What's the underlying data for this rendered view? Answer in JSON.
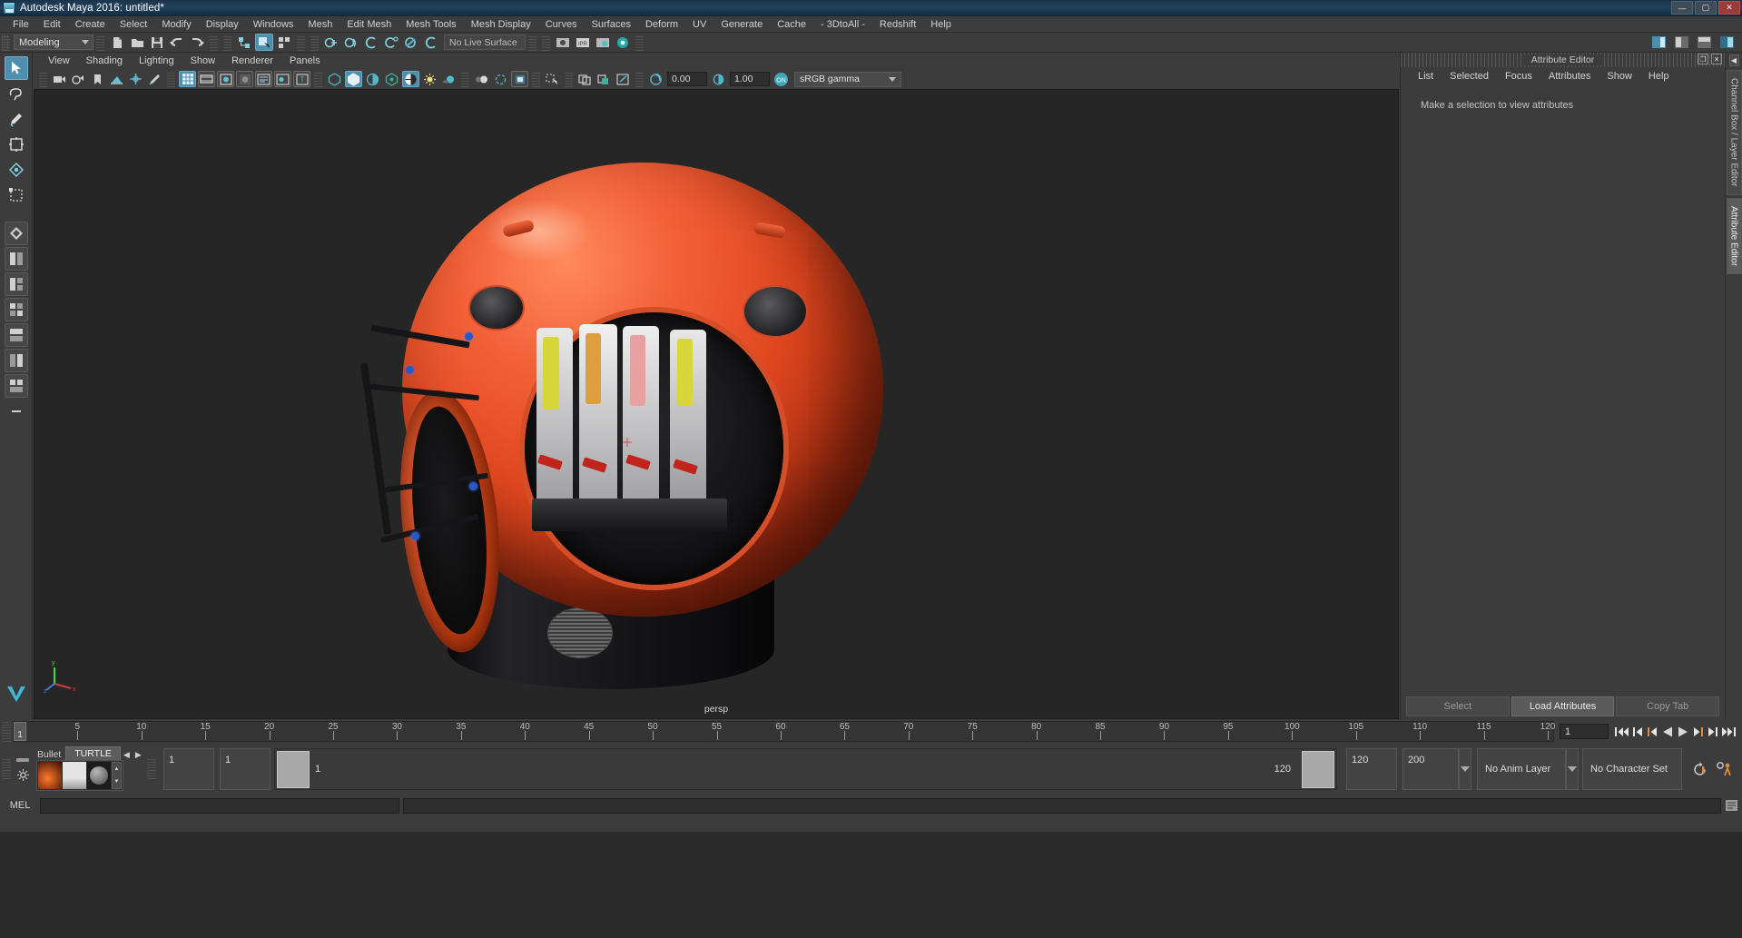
{
  "window": {
    "title": "Autodesk Maya 2016: untitled*",
    "minimize": "—",
    "maximize": "▢",
    "close": "✕"
  },
  "menubar": {
    "items": [
      "File",
      "Edit",
      "Create",
      "Select",
      "Modify",
      "Display",
      "Windows",
      "Mesh",
      "Edit Mesh",
      "Mesh Tools",
      "Mesh Display",
      "Curves",
      "Surfaces",
      "Deform",
      "UV",
      "Generate",
      "Cache",
      "- 3DtoAll -",
      "Redshift",
      "Help"
    ]
  },
  "statusline": {
    "mode": "Modeling",
    "live_surface": "No Live Surface",
    "icons": [
      "new-scene-icon",
      "open-scene-icon",
      "save-scene-icon",
      "undo-icon",
      "redo-icon",
      "select-by-hierarchy-icon",
      "select-by-object-icon",
      "select-by-component-icon",
      "snap-to-grids-icon",
      "snap-to-curves-icon",
      "snap-to-points-icon",
      "snap-to-projected-center-icon",
      "snap-to-view-planes-icon",
      "make-live-icon",
      "render-current-frame-icon",
      "ipr-render-icon",
      "render-settings-icon",
      "hypershade-icon",
      "render-view-icon"
    ]
  },
  "panel": {
    "menu": [
      "View",
      "Shading",
      "Lighting",
      "Show",
      "Renderer",
      "Panels"
    ],
    "toolbar_icons": [
      "select-camera-icon",
      "camera-attributes-icon",
      "bookmarks-icon",
      "image-plane-icon",
      "2d-pan-zoom-icon",
      "grease-pencil-icon",
      "grid-toggle-icon",
      "film-gate-icon",
      "resolution-gate-icon",
      "gate-mask-icon",
      "film-origin-icon",
      "safe-action-icon",
      "field-chart-icon",
      "wireframe-icon",
      "smooth-shade-icon",
      "shaded-wireframe-icon",
      "hardware-texturing-icon",
      "use-all-lights-icon",
      "shadows-icon",
      "screen-space-ao-icon",
      "motion-blur-icon",
      "multisample-icon",
      "isolate-select-icon",
      "xray-icon",
      "xray-joints-icon",
      "xray-active-components-icon",
      "exposure-icon",
      "gamma-icon",
      "color-management-icon"
    ],
    "exposure_value": "0.00",
    "gamma_value": "1.00",
    "color_profile": "sRGB gamma",
    "toggle_state": "ON",
    "camera_label": "persp"
  },
  "toolbox": {
    "tools": [
      "select-tool",
      "lasso-select-tool",
      "paint-select-tool",
      "move-tool",
      "rotate-tool",
      "scale-tool",
      "last-tool-used",
      "snap-grid-tool",
      "layout-single-icon",
      "layout-two-pane-icon",
      "layout-four-pane-icon",
      "layout-persp-outliner-icon",
      "layout-persp-graph-icon",
      "layout-hypershade-icon",
      "layout-more-icon"
    ]
  },
  "attribute_editor": {
    "title": "Attribute Editor",
    "dock_buttons": [
      "undock-icon",
      "close-icon"
    ],
    "menu": [
      "List",
      "Selected",
      "Focus",
      "Attributes",
      "Show",
      "Help"
    ],
    "empty_message": "Make a selection to view attributes",
    "buttons": {
      "select": "Select",
      "load_attributes": "Load Attributes",
      "copy_tab": "Copy Tab"
    },
    "active_button": "Load Attributes"
  },
  "side_tabs": {
    "items": [
      "Channel Box / Layer Editor",
      "Attribute Editor"
    ],
    "active": "Attribute Editor",
    "collapse": "◀"
  },
  "timeline": {
    "start": 1,
    "end": 120,
    "current_frame": "1",
    "tick_labels": [
      "5",
      "10",
      "15",
      "20",
      "25",
      "30",
      "35",
      "40",
      "45",
      "50",
      "55",
      "60",
      "65",
      "70",
      "75",
      "80",
      "85",
      "90",
      "95",
      "100",
      "105",
      "110",
      "115",
      "120"
    ],
    "frame_field": "1",
    "playback_buttons": [
      "go-to-start-icon",
      "step-back-frame-icon",
      "step-back-key-icon",
      "play-backwards-icon",
      "play-forwards-icon",
      "step-forward-key-icon",
      "step-forward-frame-icon",
      "go-to-end-icon"
    ]
  },
  "range_slider": {
    "anim_start": "1",
    "anim_end": "1",
    "range_start": "1",
    "range_end": "120",
    "playback_end": "120",
    "anim_end_total": "200",
    "anim_layer": "No Anim Layer",
    "character_set": "No Character Set",
    "right_icons": [
      "auto-key-icon",
      "animation-preferences-icon"
    ]
  },
  "shelf": {
    "tabs": [
      "Bullet",
      "TURTLE"
    ],
    "active_tab": "TURTLE",
    "nav": [
      "◀",
      "▶"
    ],
    "items": [
      "turtle-render-icon",
      "turtle-bake-icon",
      "turtle-sphere-icon"
    ],
    "scroll": [
      "▲",
      "▼"
    ],
    "options_icon": "shelf-options-icon",
    "handle_icon": "shelf-handle-icon"
  },
  "command_line": {
    "label": "MEL",
    "input_value": "",
    "output_value": "",
    "script_editor_icon": "script-editor-icon"
  },
  "colors": {
    "accent": "#4e8fb0",
    "panel_bg": "#3c3c3c",
    "viewport_bg": "#262626",
    "titlebar": "#21425e",
    "orange": "#e0471f",
    "highlight": "#eb8b3a"
  }
}
